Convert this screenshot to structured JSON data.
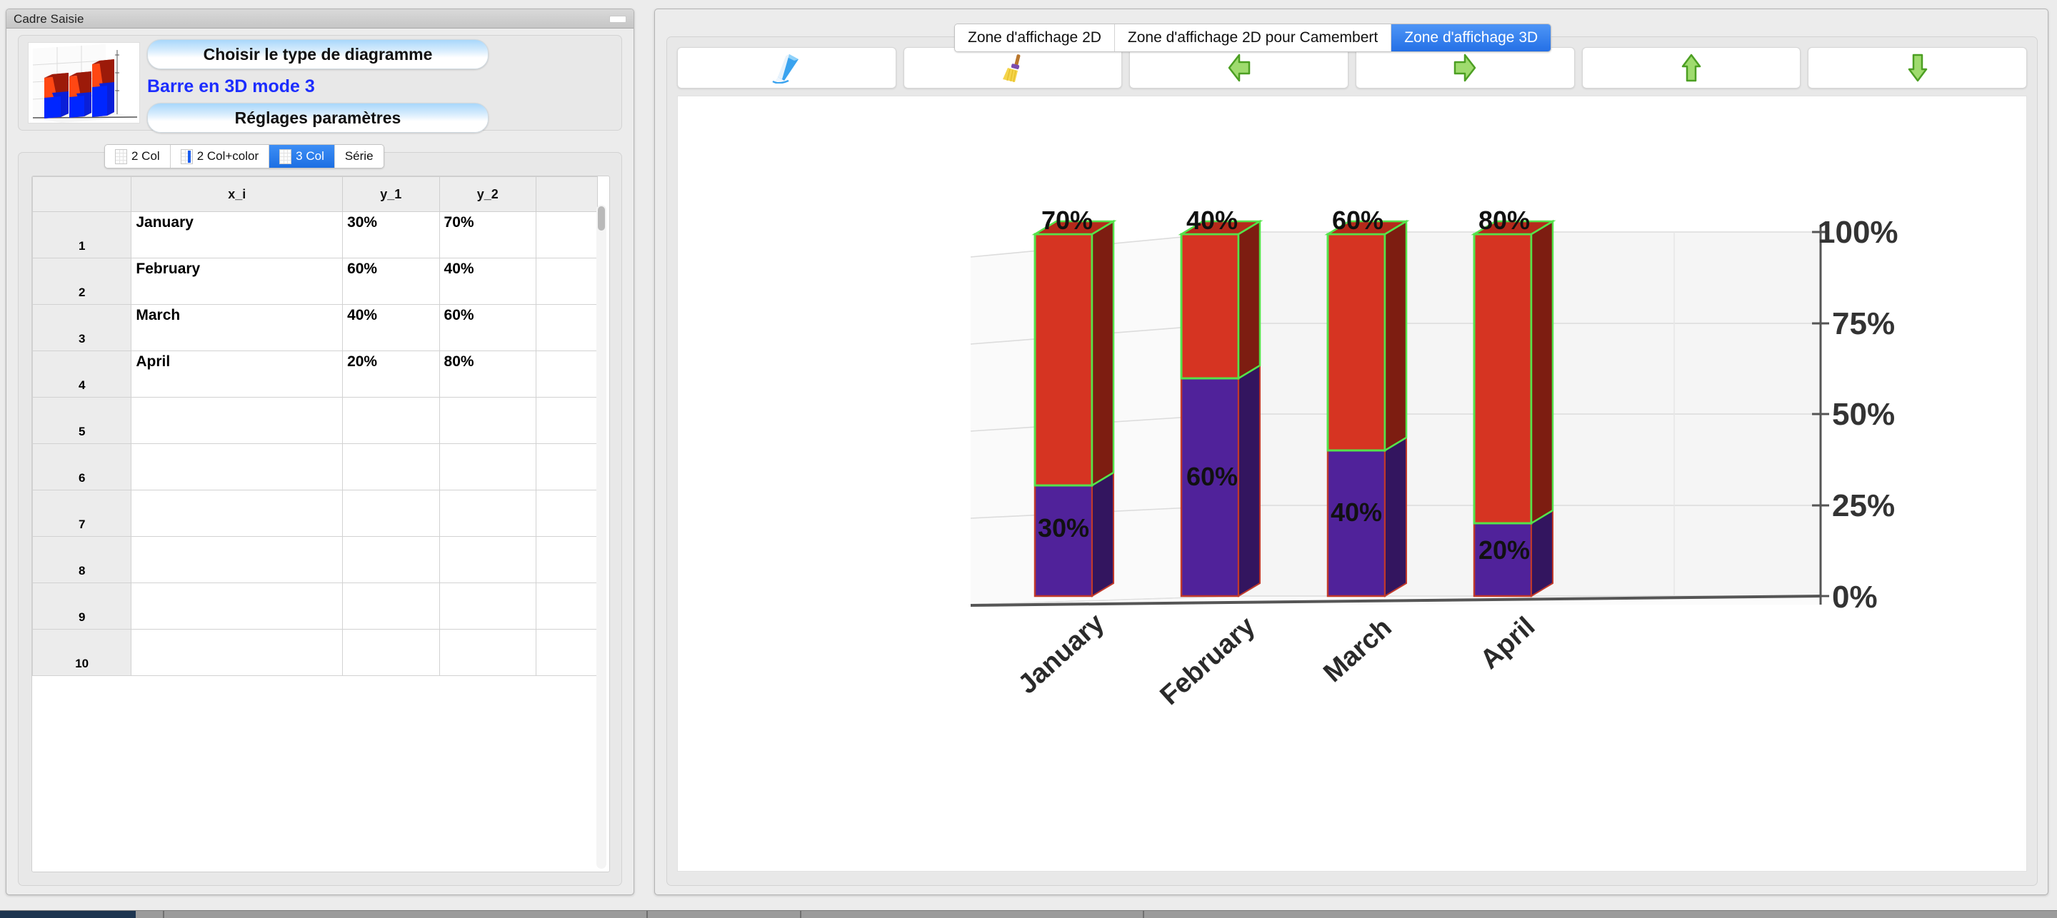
{
  "left_window": {
    "title": "Cadre Saisie",
    "minimize_icon": "minimize-icon",
    "type_group": {
      "choose_type_label": "Choisir le type de diagramme",
      "chart_type_label": "Barre en 3D mode 3",
      "settings_label": "Réglages paramètres",
      "preview_icon": "bar-chart-3d-preview"
    },
    "mode_tabs": [
      {
        "label": "2 Col",
        "selected": false,
        "icon": "spreadsheet-icon"
      },
      {
        "label": "2 Col+color",
        "selected": false,
        "icon": "spreadsheet-color-icon"
      },
      {
        "label": "3 Col",
        "selected": true,
        "icon": "spreadsheet-icon"
      },
      {
        "label": "Série",
        "selected": false,
        "icon": "spreadsheet-blank-icon"
      }
    ],
    "table": {
      "headers": [
        "",
        "x_i",
        "y_1",
        "y_2",
        ""
      ],
      "rows": [
        {
          "n": "1",
          "x_i": "January",
          "y_1": "30%",
          "y_2": "70%"
        },
        {
          "n": "2",
          "x_i": "February",
          "y_1": "60%",
          "y_2": "40%"
        },
        {
          "n": "3",
          "x_i": "March",
          "y_1": "40%",
          "y_2": "60%"
        },
        {
          "n": "4",
          "x_i": "April",
          "y_1": "20%",
          "y_2": "80%"
        },
        {
          "n": "5",
          "x_i": "",
          "y_1": "",
          "y_2": ""
        },
        {
          "n": "6",
          "x_i": "",
          "y_1": "",
          "y_2": ""
        },
        {
          "n": "7",
          "x_i": "",
          "y_1": "",
          "y_2": ""
        },
        {
          "n": "8",
          "x_i": "",
          "y_1": "",
          "y_2": ""
        },
        {
          "n": "9",
          "x_i": "",
          "y_1": "",
          "y_2": ""
        },
        {
          "n": "10",
          "x_i": "",
          "y_1": "",
          "y_2": ""
        }
      ]
    }
  },
  "right_window": {
    "view_tabs": [
      {
        "label": "Zone d'affichage 2D",
        "selected": false
      },
      {
        "label": "Zone d'affichage 2D pour Camembert",
        "selected": false
      },
      {
        "label": "Zone d'affichage 3D",
        "selected": true
      }
    ],
    "toolbar": [
      {
        "icon": "pen-draw-icon",
        "label": ""
      },
      {
        "icon": "broom-clear-icon",
        "label": ""
      },
      {
        "icon": "arrow-left-icon",
        "label": ""
      },
      {
        "icon": "arrow-right-icon",
        "label": ""
      },
      {
        "icon": "arrow-up-icon",
        "label": ""
      },
      {
        "icon": "arrow-down-icon",
        "label": ""
      }
    ]
  },
  "colors": {
    "series_y1": "#50229A",
    "series_y2": "#D63422",
    "outline_y1": "#C0392B",
    "outline_y2": "#55E34A",
    "accent_selected": "#2470E6"
  },
  "chart_data": {
    "type": "bar",
    "subtype": "stacked-3d",
    "title": "",
    "xlabel": "",
    "ylabel": "",
    "categories": [
      "January",
      "February",
      "March",
      "April"
    ],
    "series": [
      {
        "name": "y_1",
        "values": [
          30,
          60,
          40,
          20
        ],
        "labels": [
          "30%",
          "60%",
          "40%",
          "20%"
        ],
        "color": "#50229A"
      },
      {
        "name": "y_2",
        "values": [
          70,
          40,
          60,
          80
        ],
        "labels": [
          "70%",
          "40%",
          "60%",
          "80%"
        ],
        "color": "#D63422"
      }
    ],
    "ylim": [
      0,
      100
    ],
    "yticks": [
      0,
      25,
      50,
      75,
      100
    ],
    "ytick_labels": [
      "0%",
      "25%",
      "50%",
      "75%",
      "100%"
    ],
    "grid": true,
    "legend": "none",
    "xtick_rotation": -45
  }
}
